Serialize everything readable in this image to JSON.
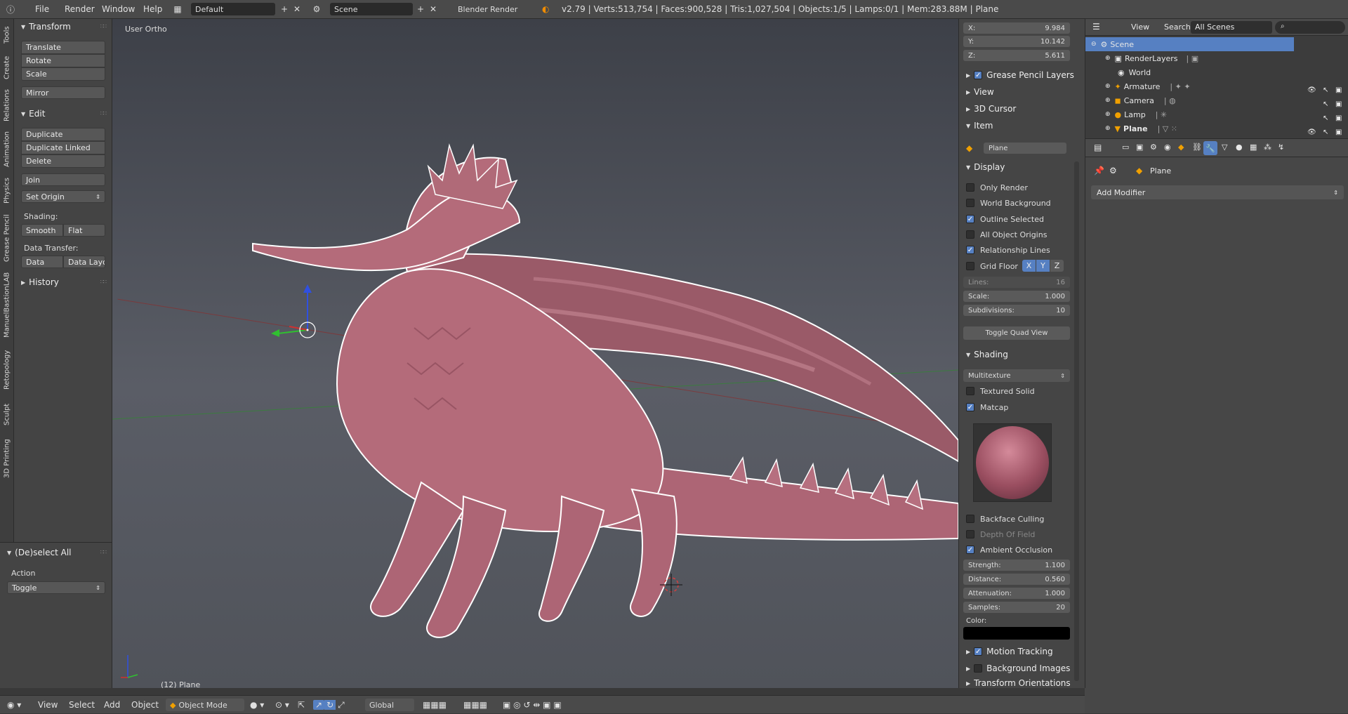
{
  "topbar": {
    "menus": [
      "File",
      "Render",
      "Window",
      "Help"
    ],
    "layout_name": "Default",
    "scene_name": "Scene",
    "engine": "Blender Render",
    "stats": "v2.79 | Verts:513,754 | Faces:900,528 | Tris:1,027,504 | Objects:1/5 | Lamps:0/1 | Mem:283.88M | Plane"
  },
  "vtabs": [
    "Tools",
    "Create",
    "Relations",
    "Animation",
    "Physics",
    "Grease Pencil",
    "ManuelBastionLAB",
    "Retopology",
    "Sculpt",
    "3D Printing"
  ],
  "toolshelf": {
    "transform": {
      "title": "Transform",
      "buttons": [
        "Translate",
        "Rotate",
        "Scale",
        "Mirror"
      ]
    },
    "edit": {
      "title": "Edit",
      "buttons": [
        "Duplicate",
        "Duplicate Linked",
        "Delete",
        "Join"
      ],
      "set_origin": "Set Origin",
      "shading_label": "Shading:",
      "smooth": "Smooth",
      "flat": "Flat",
      "data_transfer_label": "Data Transfer:",
      "data": "Data",
      "data_layout": "Data Layo"
    },
    "history": "History"
  },
  "redo": {
    "title": "(De)select All",
    "action_label": "Action",
    "action_value": "Toggle"
  },
  "viewport": {
    "view_name": "User Ortho",
    "object_label": "(12) Plane"
  },
  "npanel": {
    "x_label": "X:",
    "x_value": "9.984",
    "y_label": "Y:",
    "y_value": "10.142",
    "z_label": "Z:",
    "z_value": "5.611",
    "grease": "Grease Pencil Layers",
    "view": "View",
    "cursor": "3D Cursor",
    "item": "Item",
    "item_name": "Plane",
    "display": "Display",
    "only_render": "Only Render",
    "world_bg": "World Background",
    "outline_sel": "Outline Selected",
    "all_origins": "All Object Origins",
    "rel_lines": "Relationship Lines",
    "grid_floor": "Grid Floor",
    "axis_x": "X",
    "axis_y": "Y",
    "axis_z": "Z",
    "lines_label": "Lines:",
    "lines_value": "16",
    "scale_label": "Scale:",
    "scale_value": "1.000",
    "subdiv_label": "Subdivisions:",
    "subdiv_value": "10",
    "toggle_quad": "Toggle Quad View",
    "shading": "Shading",
    "multitexture": "Multitexture",
    "textured_solid": "Textured Solid",
    "matcap": "Matcap",
    "backface": "Backface Culling",
    "dof": "Depth Of Field",
    "ao": "Ambient Occlusion",
    "strength_label": "Strength:",
    "strength_value": "1.100",
    "distance_label": "Distance:",
    "distance_value": "0.560",
    "atten_label": "Attenuation:",
    "atten_value": "1.000",
    "samples_label": "Samples:",
    "samples_value": "20",
    "color_label": "Color:",
    "motion": "Motion Tracking",
    "bg_images": "Background Images",
    "transform_orient": "Transform Orientations"
  },
  "outliner": {
    "view": "View",
    "search": "Search",
    "filter": "All Scenes",
    "items": [
      "Scene",
      "RenderLayers",
      "World",
      "Armature",
      "Camera",
      "Lamp",
      "Plane"
    ]
  },
  "props": {
    "object_name": "Plane",
    "add_modifier": "Add Modifier"
  },
  "bottombar": {
    "menus": [
      "View",
      "Select",
      "Add",
      "Object"
    ],
    "mode": "Object Mode",
    "orientation": "Global"
  },
  "colors": {
    "accent": "#5680c2",
    "dragon": "#b06a78",
    "background": "#393939"
  }
}
